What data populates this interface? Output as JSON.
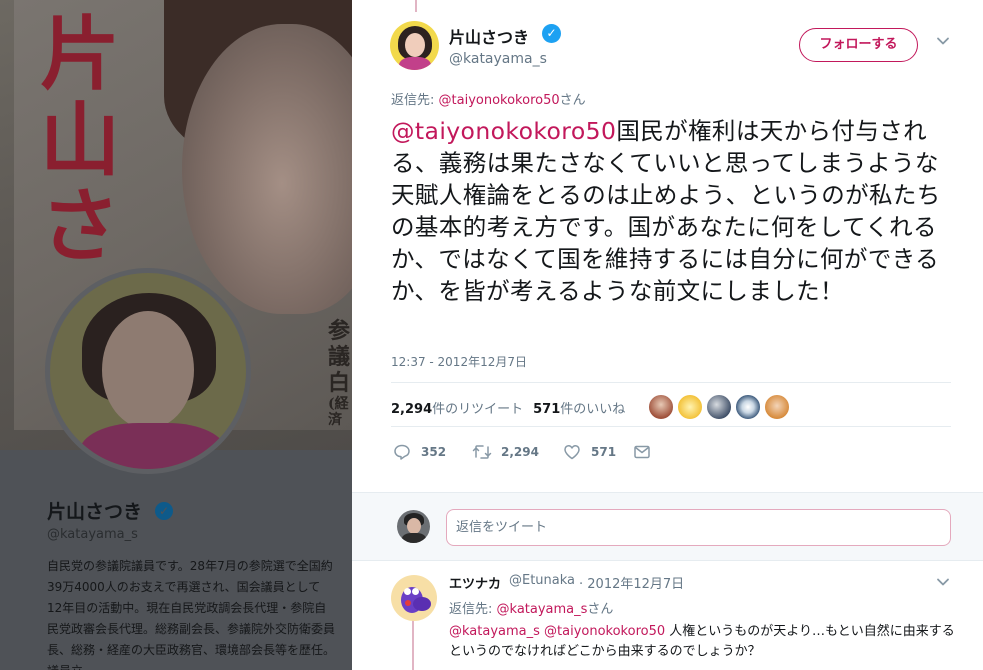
{
  "profile": {
    "banner_kanji": [
      "片",
      "山",
      "さ"
    ],
    "banner_text_lines": [
      "参議",
      "白",
      "(経済"
    ],
    "name": "片山さつき",
    "handle": "@katayama_s",
    "bio": "自民党の参議院議員です。28年7月の参院選で全国約39万4000人のお支えで再選され、国会議員として12年目の活動中。現在自民党政調会長代理・参院自民党政審会長代理。総務副会長、参議院外交防衛委員長、総務・経産の大臣政務官、環境部会長等を歴任。議員立"
  },
  "tweet": {
    "author_name": "片山さつき",
    "author_handle": "@katayama_s",
    "follow_label": "フォローする",
    "reply_to_prefix": "返信先: ",
    "reply_to_mention": "@taiyonokokoro50",
    "reply_to_suffix": "さん",
    "text_mention": "@taiyonokokoro50",
    "text_body": "国民が権利は天から付与される、義務は果たさなくていいと思ってしまうような天賦人権論をとるのは止めよう、というのが私たちの基本的考え方です。国があなたに何をしてくれるか、ではなくて国を維持するには自分に何ができるか、を皆が考えるような前文にしました！",
    "timestamp": "12:37 - 2012年12月7日",
    "retweet_count": "2,294",
    "retweet_label": "件のリツイート",
    "like_count": "571",
    "like_label": "件のいいね",
    "actions": {
      "reply_count": "352",
      "retweet_count": "2,294",
      "like_count": "571"
    }
  },
  "reply_box": {
    "placeholder": "返信をツイート"
  },
  "reply_tweet": {
    "name": "エツナカ",
    "handle": "@Etunaka",
    "separator": "·",
    "date": "2012年12月7日",
    "reply_to_prefix": "返信先: ",
    "reply_to_mention": "@katayama_s",
    "reply_to_suffix": "さん",
    "mentions": "@katayama_s @taiyonokokoro50",
    "text": " 人権というものが天より…もとい自然に由来するというのでなければどこから由来するのでしょうか？"
  },
  "colors": {
    "accent": "#c2185b",
    "verified": "#1da1f2",
    "muted": "#657786"
  },
  "icons": [
    "verified-badge-icon",
    "chevron-down-icon",
    "reply-icon",
    "retweet-icon",
    "heart-icon",
    "message-icon"
  ]
}
